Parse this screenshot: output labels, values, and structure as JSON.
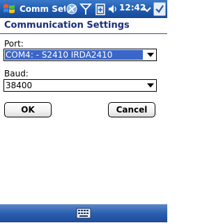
{
  "window": {
    "app_title": "Comm Settings",
    "clock": "12:42"
  },
  "page": {
    "title": "Communication Settings"
  },
  "form": {
    "port": {
      "label": "Port:",
      "value": "COM4: - S2410 IRDA2410"
    },
    "baud": {
      "label": "Baud:",
      "value": "38400"
    }
  },
  "buttons": {
    "ok": "OK",
    "cancel": "Cancel"
  },
  "colors": {
    "titlebar": "#1f5bb0",
    "selection": "#3b66c9",
    "heading": "#1a2f7a"
  },
  "icons": {
    "start": "windows-flag-icon",
    "connectivity": "connectivity-icon",
    "signal": "signal-antenna-icon",
    "battery": "battery-icon",
    "volume": "speaker-icon",
    "ok": "ok-check-icon",
    "keyboard": "keyboard-icon"
  }
}
